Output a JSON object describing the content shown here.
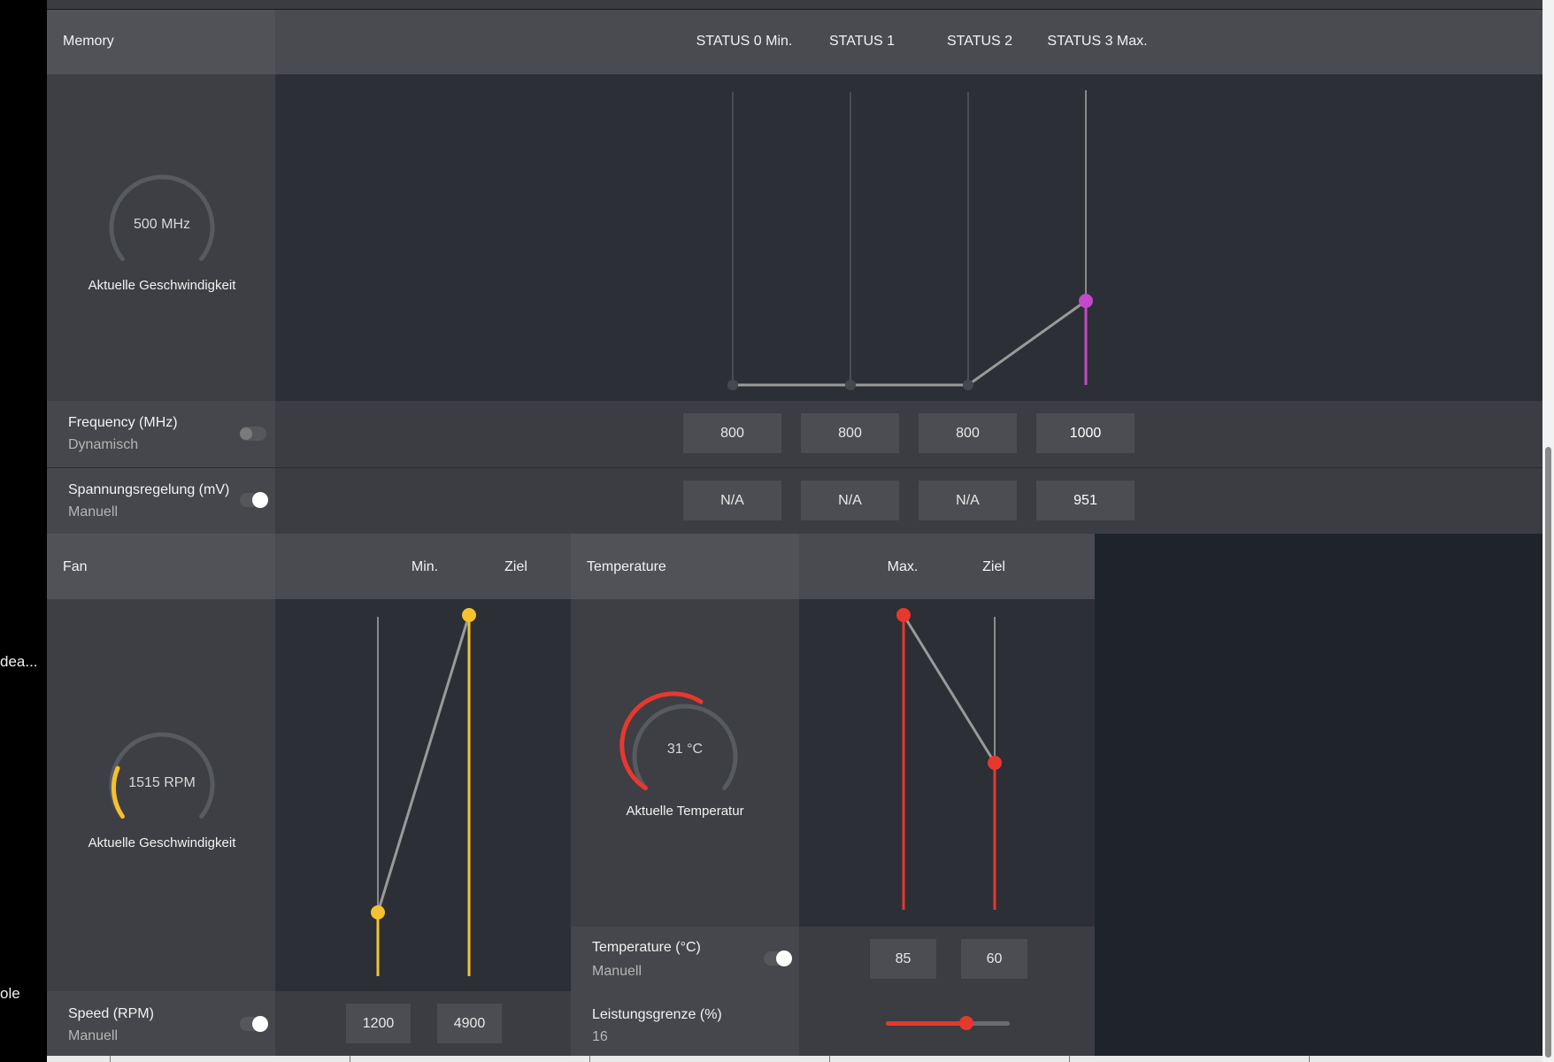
{
  "left_fragments": {
    "frag1": "dea...",
    "frag2": "ole"
  },
  "memory": {
    "title": "Memory",
    "states": [
      "STATUS 0 Min.",
      "STATUS 1",
      "STATUS 2",
      "STATUS 3 Max."
    ],
    "gauge": {
      "value": "500 MHz",
      "label": "Aktuelle Geschwindigkeit"
    },
    "frequency": {
      "label": "Frequency (MHz)",
      "mode": "Dynamisch",
      "toggle_on": false,
      "values": [
        "800",
        "800",
        "800",
        "1000"
      ]
    },
    "voltage": {
      "label": "Spannungsregelung (mV)",
      "mode": "Manuell",
      "toggle_on": true,
      "values": [
        "N/A",
        "N/A",
        "N/A",
        "951"
      ]
    }
  },
  "fan": {
    "title": "Fan",
    "cols": [
      "Min.",
      "Ziel"
    ],
    "gauge": {
      "value": "1515 RPM",
      "label": "Aktuelle Geschwindigkeit"
    },
    "speed": {
      "label": "Speed (RPM)",
      "mode": "Manuell",
      "toggle_on": true,
      "values": [
        "1200",
        "4900"
      ]
    }
  },
  "temperature": {
    "title": "Temperature",
    "cols": [
      "Max.",
      "Ziel"
    ],
    "gauge": {
      "value": "31 °C",
      "label": "Aktuelle Temperatur"
    },
    "temp": {
      "label": "Temperature (°C)",
      "mode": "Manuell",
      "toggle_on": true,
      "values": [
        "85",
        "60"
      ]
    },
    "power": {
      "label": "Leistungsgrenze (%)",
      "value": "16",
      "slider_fraction": 0.65
    }
  },
  "colors": {
    "accent_memory": "#c04ac8",
    "accent_fan": "#f5c12e",
    "accent_temp": "#e8382e"
  }
}
